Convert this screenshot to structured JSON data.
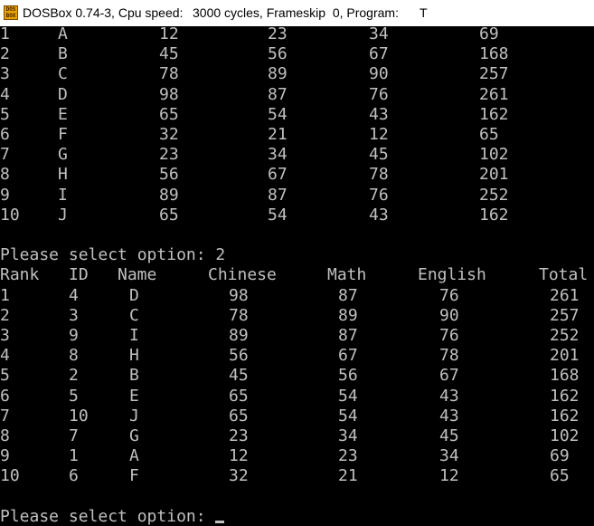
{
  "window": {
    "title_app": "DOSBox 0.74-3, Cpu speed:",
    "title_cycles": "3000 cycles, Frameskip  0, Program:",
    "title_program": "T",
    "icon_label_top": "DOS",
    "icon_label_bottom": "BOX"
  },
  "colors": {
    "console_bg": "#000000",
    "console_text": "#c0c0c0",
    "titlebar_bg": "#ffffff"
  },
  "console": {
    "first_table": [
      [
        "1",
        "A",
        "12",
        "23",
        "34",
        "69"
      ],
      [
        "2",
        "B",
        "45",
        "56",
        "67",
        "168"
      ],
      [
        "3",
        "C",
        "78",
        "89",
        "90",
        "257"
      ],
      [
        "4",
        "D",
        "98",
        "87",
        "76",
        "261"
      ],
      [
        "5",
        "E",
        "65",
        "54",
        "43",
        "162"
      ],
      [
        "6",
        "F",
        "32",
        "21",
        "12",
        "65"
      ],
      [
        "7",
        "G",
        "23",
        "34",
        "45",
        "102"
      ],
      [
        "8",
        "H",
        "56",
        "67",
        "78",
        "201"
      ],
      [
        "9",
        "I",
        "89",
        "87",
        "76",
        "252"
      ],
      [
        "10",
        "J",
        "65",
        "54",
        "43",
        "162"
      ]
    ],
    "prompt_1": "Please select option: 2",
    "headers": [
      "Rank",
      "ID",
      "Name",
      "Chinese",
      "Math",
      "English",
      "Total"
    ],
    "ranked_table": [
      [
        "1",
        "4",
        "D",
        "98",
        "87",
        "76",
        "261"
      ],
      [
        "2",
        "3",
        "C",
        "78",
        "89",
        "90",
        "257"
      ],
      [
        "3",
        "9",
        "I",
        "89",
        "87",
        "76",
        "252"
      ],
      [
        "4",
        "8",
        "H",
        "56",
        "67",
        "78",
        "201"
      ],
      [
        "5",
        "2",
        "B",
        "45",
        "56",
        "67",
        "168"
      ],
      [
        "6",
        "5",
        "E",
        "65",
        "54",
        "43",
        "162"
      ],
      [
        "7",
        "10",
        "J",
        "65",
        "54",
        "43",
        "162"
      ],
      [
        "8",
        "7",
        "G",
        "23",
        "34",
        "45",
        "102"
      ],
      [
        "9",
        "1",
        "A",
        "12",
        "23",
        "34",
        "69"
      ],
      [
        "10",
        "6",
        "F",
        "32",
        "21",
        "12",
        "65"
      ]
    ],
    "prompt_2": "Please select option:"
  }
}
